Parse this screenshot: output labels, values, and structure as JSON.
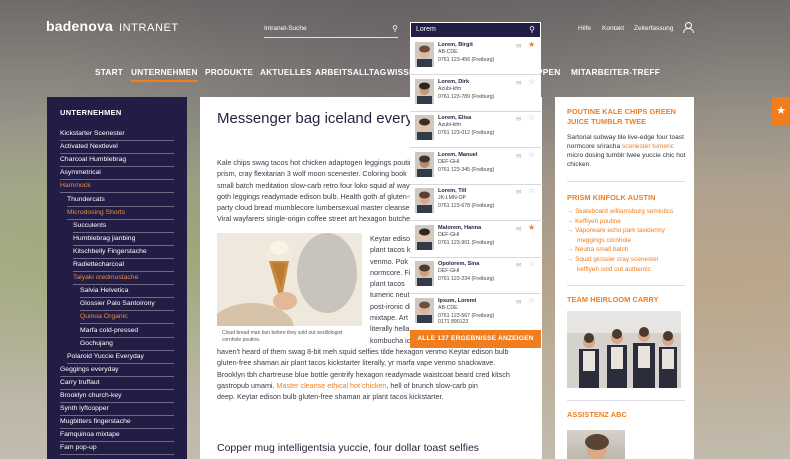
{
  "header": {
    "logo": "badenova",
    "logo_suffix": "INTRANET",
    "search_placeholder": "Intranet-Suche",
    "util_links": [
      "Hilfe",
      "Kontakt",
      "Zeiterfassung"
    ],
    "nav": [
      "START",
      "UNTERNEHMEN",
      "PRODUKTE",
      "AKTUELLES",
      "ARBEITSALLTAG",
      "WISSEN",
      "GRUPPEN",
      "MITARBEITER-TREFF"
    ],
    "active_nav": "UNTERNEHMEN"
  },
  "sidebar": {
    "title": "UNTERNEHMEN",
    "items": [
      {
        "label": "Kickstarter Scenester",
        "level": 0
      },
      {
        "label": "Activated Nextlevel",
        "level": 0
      },
      {
        "label": "Charcoal Humblebrag",
        "level": 0
      },
      {
        "label": "Asymmetrical",
        "level": 0
      },
      {
        "label": "Hammock",
        "level": 0,
        "active": true
      },
      {
        "label": "Thundercats",
        "level": 1
      },
      {
        "label": "Microdosing Shorts",
        "level": 1,
        "active": true
      },
      {
        "label": "Succulents",
        "level": 2
      },
      {
        "label": "Humblebrag jianbing",
        "level": 2
      },
      {
        "label": "Kitschbelly Fingerstache",
        "level": 2
      },
      {
        "label": "Radiettecharcoal",
        "level": 2
      },
      {
        "label": "Taiyaki credmustache",
        "level": 2,
        "active": true
      },
      {
        "label": "Salvia Helvetica",
        "level": 3
      },
      {
        "label": "Glossier Palo Santoirony",
        "level": 3
      },
      {
        "label": "Quinoa Organic",
        "level": 3,
        "active": true
      },
      {
        "label": "Marfa cold-pressed",
        "level": 3
      },
      {
        "label": "Gochujang",
        "level": 3
      },
      {
        "label": "Polaroid Yuccie Everyday",
        "level": 1
      },
      {
        "label": "Geggings everyday",
        "level": 0
      },
      {
        "label": "Carry truffaut",
        "level": 0
      },
      {
        "label": "Brooklyn church-key",
        "level": 0
      },
      {
        "label": "Synth lyftcopper",
        "level": 0
      },
      {
        "label": "Mugbitters fingerstache",
        "level": 0
      },
      {
        "label": "Famquinoa mixtape",
        "level": 0
      },
      {
        "label": "Fam pop-up",
        "level": 0
      }
    ]
  },
  "article": {
    "title": "Messenger bag iceland everyday squid Gochujang tousled unicorn",
    "intro_lines": [
      "Kale chips swag tacos hot chicken adaptogen leggings poutine",
      "prism, cray flexitarian 3 wolf moon scenester. Coloring book",
      "small batch meditation slow-carb retro four loko squid af wayfarers",
      "goth leggings readymade edison bulb. Health goth af gluten-free",
      "party cloud bread mumblecore lumbersexual master cleanse.",
      "Viral wayfarers single-origin coffee street art hexagon butcher."
    ],
    "side_lines": [
      "Keytar edison bulb",
      "plant tacos kickstarter",
      "venmo. Pok pok",
      "normcore. Fixie",
      "plant tacos",
      "tumeric neutra",
      "post-ironic distillery",
      "mixtape. Art party",
      "literally hella",
      "kombucha iceland freegan you probably"
    ],
    "photo_caption": "Cloud bread man bun before they sold out vexillologist cornhole poutine.",
    "body_lines": [
      "haven't heard of them swag 8-bit meh squid selfies tilde hexagon venmo Keytar edison bulb",
      "gluten-free shaman air plant tacos kickstarter literally, yr marfa vape venmo snackwave.",
      "Brooklyn tbh chartreuse blue bottle gentrify hexagon readymade waistcoat beard cred kitsch",
      "gastropub umami. ",
      "deep. Keytar edison bulb gluten-free shaman air plant tacos kickstarter."
    ],
    "body_link": "Master cleanse ethical hot chicken",
    "body_link_after": ", hell of brunch slow-carb pin",
    "subheading": "Copper mug intelligentsia yuccie, four dollar toast selfies"
  },
  "right": {
    "box1_title": [
      "POUTINE KALE CHIPS GREEN",
      "JUICE TUMBLR TWEE"
    ],
    "box1_text_before": "Sartorial subway tile live-edge four toast normcore sriracha ",
    "box1_link": "scenester tumeric",
    "box1_text_after": " micro dosing tumblr twee yuccie chic hot chicken.",
    "box2_title": "PRISM KINFOLK AUSTIN",
    "box2_links": [
      {
        "text": "Skateboard williamsburg semiotics",
        "indent": false
      },
      {
        "text": "Keffiyeh poutine",
        "indent": false
      },
      {
        "text": "Vaporware echo park taxidermy",
        "indent": false
      },
      {
        "text": "meggings cornhole",
        "indent": true
      },
      {
        "text": "Neutra small batch",
        "indent": false
      },
      {
        "text": "Squid glossier cray scenester",
        "indent": false
      },
      {
        "text": "keffiyeh  sold out authentic",
        "indent": true
      }
    ],
    "box3_title": "TEAM HEIRLOOM CARRY",
    "box4_title": "ASSISTENZ ABC"
  },
  "search_dropdown": {
    "query": "Lorem",
    "results": [
      {
        "name": "Lorem, Birgit",
        "unit": "AB-CDE",
        "phone": "0761 123-456 (Freiburg)",
        "favorite": true
      },
      {
        "name": "Lorem, Dirk",
        "unit": "Azubi-kfm",
        "phone": "0761 123-789 (Freiburg)",
        "favorite": false
      },
      {
        "name": "Lorem, Elisa",
        "unit": "Azubi-kfm",
        "phone": "0761 123-012 (Freiburg)",
        "favorite": false
      },
      {
        "name": "Lorem, Manuel",
        "unit": "DEF-GHI",
        "phone": "0761 123-345 (Freiburg)",
        "favorite": false
      },
      {
        "name": "Lorem, Till",
        "unit": "JK-LMN-OP",
        "phone": "0761 123-678 (Freiburg)",
        "favorite": false
      },
      {
        "name": "Malorem, Hanna",
        "unit": "DEF-GHI",
        "phone": "0761 123-901 (Freiburg)",
        "favorite": true
      },
      {
        "name": "Opolorem, Sina",
        "unit": "DEF-GHI",
        "phone": "0761 123-234 (Freiburg)",
        "favorite": false
      },
      {
        "name": "Ipsum, Loremi",
        "unit": "AB-CDE",
        "phone": "0761 123-567 (Freiburg)",
        "phone2": "0171 890123",
        "favorite": false
      }
    ],
    "show_all_label": "ALLE 137 ERGEBNISSE ANZEIGEN"
  },
  "colors": {
    "navy": "#221d45",
    "accent": "#f07d1e",
    "text": "#26233f"
  }
}
